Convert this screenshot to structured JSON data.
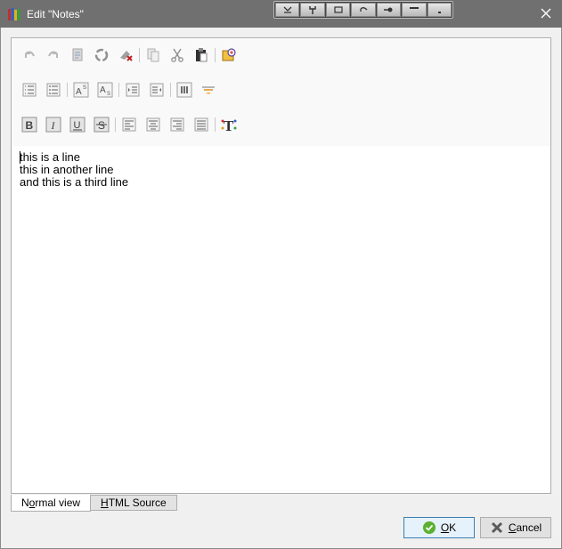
{
  "window": {
    "title": "Edit \"Notes\"",
    "close_glyph": "✕"
  },
  "editor": {
    "lines": [
      "this is a line",
      "this in another line",
      "and this is a third line"
    ]
  },
  "tabs": [
    {
      "label": "Normal view",
      "mnemonic": "o",
      "active": true
    },
    {
      "label": "HTML Source",
      "mnemonic": "H",
      "active": false
    }
  ],
  "buttons": {
    "ok": {
      "label": "OK",
      "mnemonic": "O"
    },
    "cancel": {
      "label": "Cancel",
      "mnemonic": "C"
    }
  },
  "toolbar": {
    "row1": [
      "undo-icon",
      "redo-icon",
      "document-icon",
      "recycle-icon",
      "eraser-icon",
      "copy-icon",
      "cut-icon",
      "paste-icon",
      "insert-special-icon"
    ],
    "row2": [
      "numbered-list-icon",
      "bullet-list-icon",
      "superscript-icon",
      "subscript-icon",
      "indent-decrease-icon",
      "indent-increase-icon",
      "table-icon",
      "horizontal-rule-icon"
    ],
    "row3": [
      "bold-icon",
      "italic-icon",
      "underline-icon",
      "strikethrough-icon",
      "align-left-icon",
      "align-center-icon",
      "align-right-icon",
      "justify-icon",
      "font-color-icon"
    ]
  },
  "floating_toolbar": [
    "expand-icon",
    "tools-icon",
    "window-icon",
    "undo-arrow-icon",
    "key-icon",
    "minimize-bar-icon",
    "dot-icon"
  ],
  "colors": {
    "titlebar": "#707070",
    "ok_check": "#5cb030",
    "cancel_x": "#5a5a5a",
    "eraser": "#c02020"
  }
}
